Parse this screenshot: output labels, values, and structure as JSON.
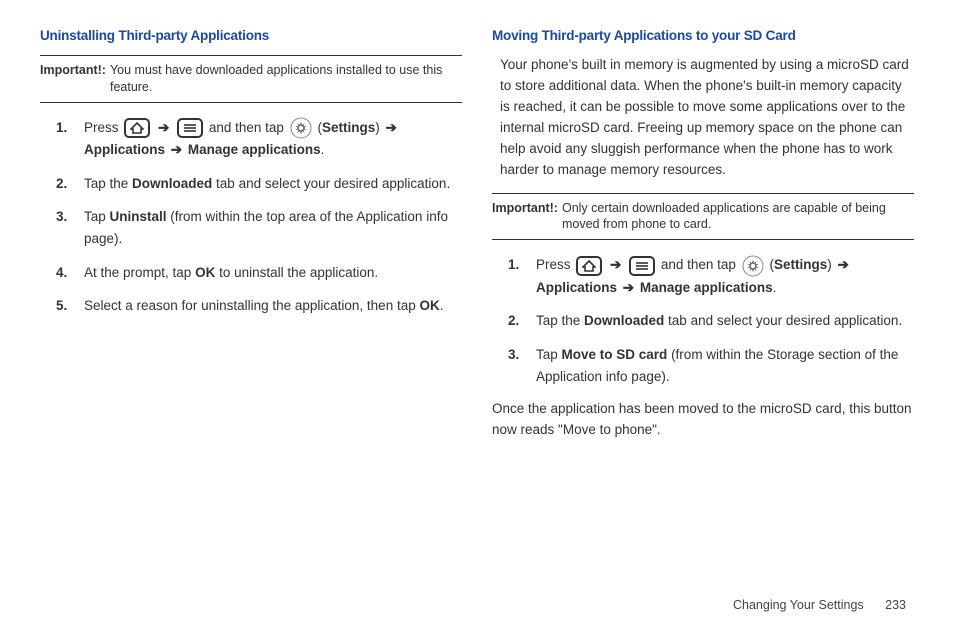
{
  "left": {
    "heading": "Uninstalling Third-party Applications",
    "important_label": "Important!:",
    "important_text": "You must have downloaded applications installed to use this feature.",
    "steps": {
      "s1": {
        "a": "Press ",
        "b": " and then tap ",
        "c": " (",
        "settings": "Settings",
        "d": ") ",
        "applications": "Applications",
        "manage": "Manage applications",
        "dot": "."
      },
      "s2": {
        "a": "Tap the ",
        "downloaded": "Downloaded",
        "b": " tab and select your desired application."
      },
      "s3": {
        "a": "Tap ",
        "uninstall": "Uninstall",
        "b": " (from within the top area of the Application info page)."
      },
      "s4": {
        "a": "At the prompt, tap ",
        "ok": "OK",
        "b": " to uninstall the application."
      },
      "s5": {
        "a": "Select a reason for uninstalling the application, then tap ",
        "ok": "OK",
        "b": "."
      }
    }
  },
  "right": {
    "heading": "Moving Third-party Applications to your SD Card",
    "intro": "Your phone's built in memory is augmented by using a microSD card to store additional data. When the phone's built-in memory capacity is reached, it can be possible to move some applications over to the internal microSD card. Freeing up memory space on the phone can help avoid any sluggish performance when the phone has to work harder to manage memory resources.",
    "important_label": "Important!:",
    "important_text": "Only certain downloaded applications are capable of being moved from phone to card.",
    "steps": {
      "s1": {
        "a": "Press ",
        "b": " and then tap ",
        "c": " (",
        "settings": "Settings",
        "d": ") ",
        "applications": "Applications",
        "manage": "Manage applications",
        "dot": "."
      },
      "s2": {
        "a": "Tap the ",
        "downloaded": "Downloaded",
        "b": " tab and select your desired application."
      },
      "s3": {
        "a": "Tap ",
        "move": "Move to SD card",
        "b": " (from within the Storage section of the Application info page)."
      }
    },
    "outro": "Once the application has been moved to the microSD card, this button now reads \"Move to phone\"."
  },
  "footer": {
    "section": "Changing Your Settings",
    "page": "233"
  },
  "glyph": {
    "arrow": "➔"
  }
}
